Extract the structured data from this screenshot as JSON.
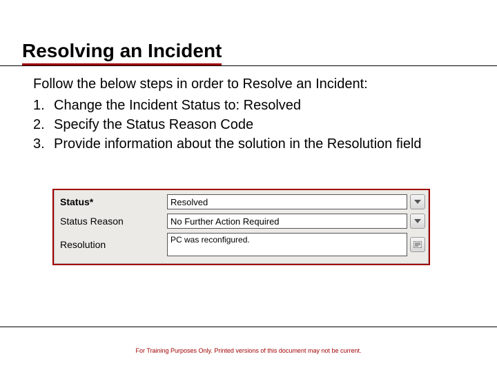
{
  "title": "Resolving an Incident",
  "intro": "Follow the below steps in order to Resolve an Incident:",
  "steps": [
    {
      "num": "1.",
      "text": "Change the Incident Status to: Resolved"
    },
    {
      "num": "2.",
      "text": "Specify the Status Reason Code"
    },
    {
      "num": "3.",
      "text": "Provide information about the solution in the Resolution field"
    }
  ],
  "form": {
    "status_label": "Status*",
    "status_value": "Resolved",
    "reason_label": "Status Reason",
    "reason_value": "No Further Action Required",
    "resolution_label": "Resolution",
    "resolution_value": "PC was reconfigured."
  },
  "footer": "For Training Purposes Only. Printed versions of this document may not be current."
}
